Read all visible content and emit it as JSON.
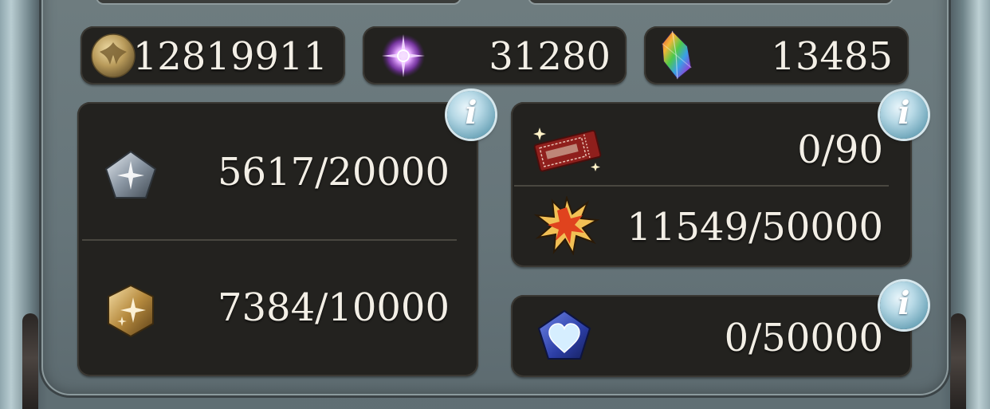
{
  "currencies": [
    {
      "name": "rupie",
      "icon": "gold-coin-icon",
      "value": "12819911"
    },
    {
      "name": "crystal-fragment",
      "icon": "purple-sparkle-icon",
      "value": "31280"
    },
    {
      "name": "crystal",
      "icon": "rainbow-crystal-icon",
      "value": "13485"
    }
  ],
  "left_box": {
    "info_icon": "info-icon",
    "info_label": "i",
    "rows": [
      {
        "icon": "silver-pentagon-sparkle-icon",
        "value": "5617/20000"
      },
      {
        "icon": "gold-hexagon-sparkle-icon",
        "value": "7384/10000"
      }
    ]
  },
  "right_top_box": {
    "info_icon": "info-icon",
    "info_label": "i",
    "rows": [
      {
        "icon": "red-ticket-icon",
        "value": "0/90"
      },
      {
        "icon": "orange-burst-star-icon",
        "value": "11549/50000"
      }
    ]
  },
  "right_bottom_box": {
    "info_icon": "info-icon",
    "info_label": "i",
    "rows": [
      {
        "icon": "blue-heart-pentagon-icon",
        "value": "0/50000"
      }
    ]
  },
  "colors": {
    "panel": "#66757a",
    "box_bg": "#23221f",
    "text": "#f3efe6",
    "info_button": "#b7d9e6",
    "accent_orange": "#e8902a",
    "accent_red": "#c6302a"
  }
}
